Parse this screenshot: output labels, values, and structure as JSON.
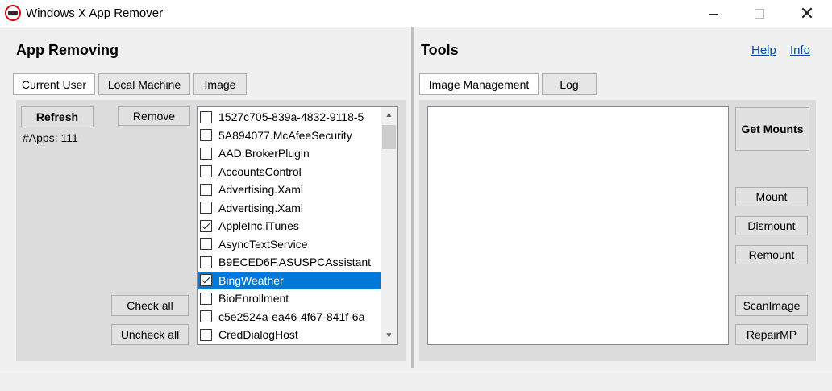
{
  "window": {
    "title": "Windows X App Remover",
    "icon": "no-entry-icon",
    "close_glyph": "✕"
  },
  "left": {
    "section_title": "App Removing",
    "tabs": [
      {
        "label": "Current User",
        "active": true
      },
      {
        "label": "Local Machine",
        "active": false
      },
      {
        "label": "Image",
        "active": false
      }
    ],
    "refresh_label": "Refresh",
    "remove_label": "Remove",
    "apps_count": "#Apps: 111",
    "check_all_label": "Check all",
    "uncheck_all_label": "Uncheck all",
    "apps": [
      {
        "name": "1527c705-839a-4832-9118-5",
        "checked": false,
        "selected": false
      },
      {
        "name": "5A894077.McAfeeSecurity",
        "checked": false,
        "selected": false
      },
      {
        "name": "AAD.BrokerPlugin",
        "checked": false,
        "selected": false
      },
      {
        "name": "AccountsControl",
        "checked": false,
        "selected": false
      },
      {
        "name": "Advertising.Xaml",
        "checked": false,
        "selected": false
      },
      {
        "name": "Advertising.Xaml",
        "checked": false,
        "selected": false
      },
      {
        "name": "AppleInc.iTunes",
        "checked": true,
        "selected": false
      },
      {
        "name": "AsyncTextService",
        "checked": false,
        "selected": false
      },
      {
        "name": "B9ECED6F.ASUSPCAssistant",
        "checked": false,
        "selected": false
      },
      {
        "name": "BingWeather",
        "checked": true,
        "selected": true
      },
      {
        "name": "BioEnrollment",
        "checked": false,
        "selected": false
      },
      {
        "name": "c5e2524a-ea46-4f67-841f-6a",
        "checked": false,
        "selected": false
      },
      {
        "name": "CredDialogHost",
        "checked": false,
        "selected": false
      }
    ],
    "scroll_up_glyph": "▲",
    "scroll_down_glyph": "▼"
  },
  "right": {
    "section_title": "Tools",
    "help_label": "Help",
    "info_label": "Info",
    "tabs": [
      {
        "label": "Image Management",
        "active": true
      },
      {
        "label": "Log",
        "active": false
      }
    ],
    "get_mounts_label": "Get Mounts",
    "mount_label": "Mount",
    "dismount_label": "Dismount",
    "remount_label": "Remount",
    "scan_image_label": "ScanImage",
    "repair_mp_label": "RepairMP"
  },
  "colors": {
    "selection": "#0078d7",
    "link": "#0645ad"
  }
}
